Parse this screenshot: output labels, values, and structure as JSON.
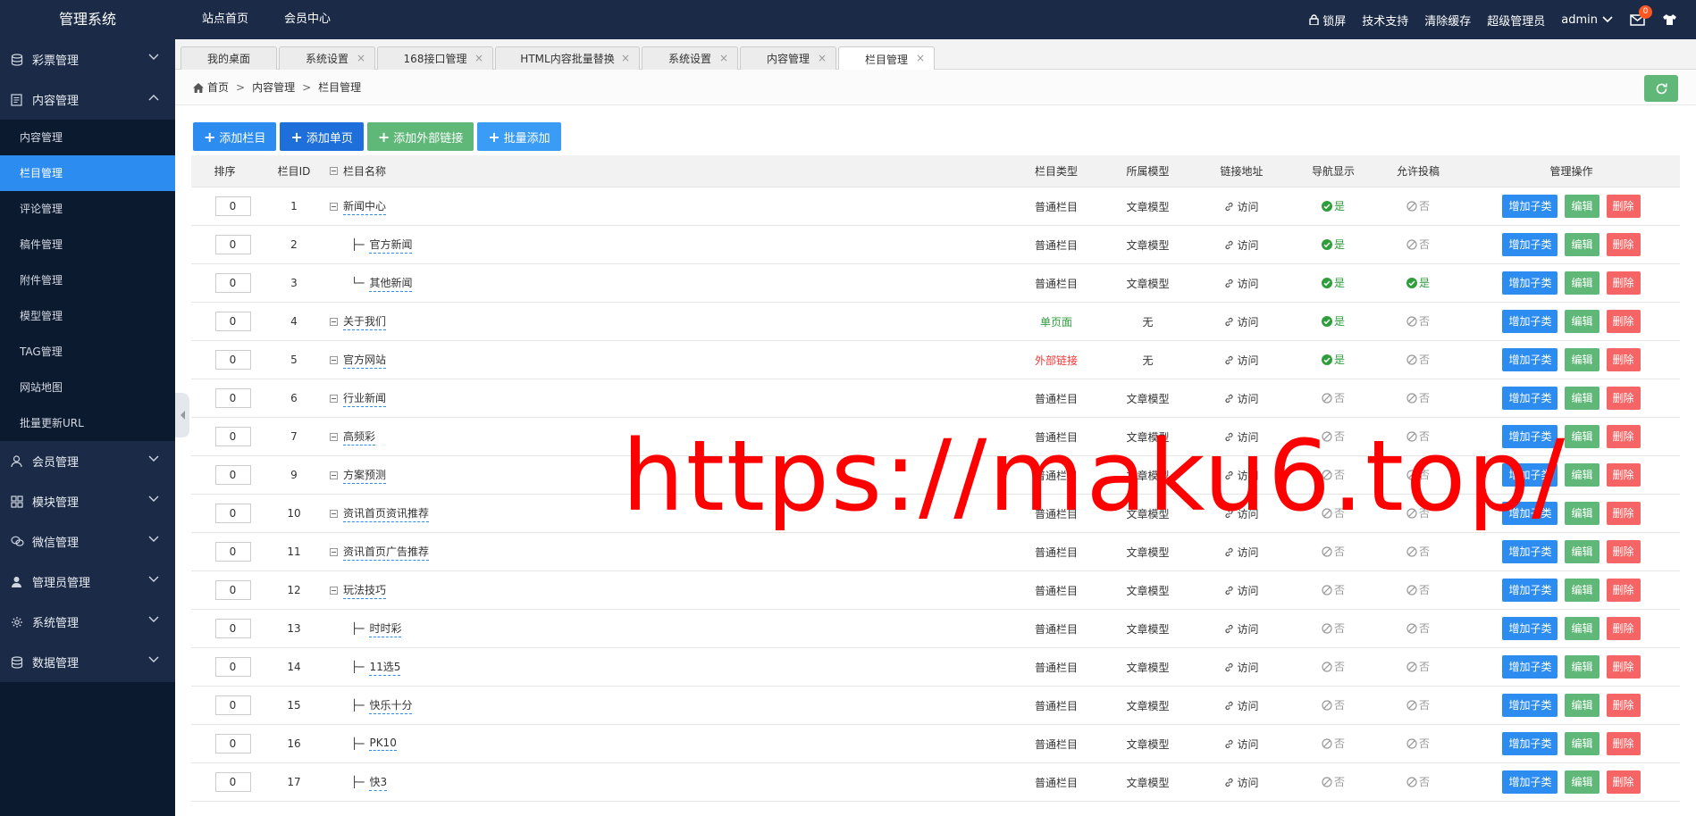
{
  "app": {
    "title": "管理系统",
    "top_nav": [
      "站点首页",
      "会员中心"
    ],
    "top_right": {
      "lock": "锁屏",
      "support": "技术支持",
      "clear_cache": "清除缓存",
      "role": "超级管理员",
      "user": "admin",
      "mail_count": "0"
    }
  },
  "sidebar": {
    "groups_top": [
      {
        "label": "彩票管理",
        "icon": "database-icon"
      },
      {
        "label": "内容管理",
        "icon": "document-icon"
      }
    ],
    "content_items": [
      "内容管理",
      "栏目管理",
      "评论管理",
      "稿件管理",
      "附件管理",
      "模型管理",
      "TAG管理",
      "网站地图",
      "批量更新URL"
    ],
    "active_item": "栏目管理",
    "groups_bottom": [
      {
        "label": "会员管理",
        "icon": "user-icon"
      },
      {
        "label": "模块管理",
        "icon": "grid-icon"
      },
      {
        "label": "微信管理",
        "icon": "wechat-icon"
      },
      {
        "label": "管理员管理",
        "icon": "admin-icon"
      },
      {
        "label": "系统管理",
        "icon": "gear-icon"
      },
      {
        "label": "数据管理",
        "icon": "database-icon"
      }
    ]
  },
  "tabs": [
    "我的桌面",
    "系统设置",
    "168接口管理",
    "HTML内容批量替换",
    "系统设置",
    "内容管理",
    "栏目管理"
  ],
  "breadcrumb": [
    "首页",
    "内容管理",
    "栏目管理"
  ],
  "actions": [
    {
      "label": "添加栏目",
      "color": "#2d8cf0"
    },
    {
      "label": "添加单页",
      "color": "#1e6fd9"
    },
    {
      "label": "添加外部链接",
      "color": "#5fb878"
    },
    {
      "label": "批量添加",
      "color": "#3b9cf5"
    }
  ],
  "table": {
    "headers": {
      "sort": "排序",
      "id": "栏目ID",
      "name": "栏目名称",
      "type": "栏目类型",
      "model": "所属模型",
      "link": "链接地址",
      "nav": "导航显示",
      "post": "允许投稿",
      "op": "管理操作"
    },
    "link_text": "访问",
    "yes_text": "是",
    "no_text": "否",
    "btn_add": "增加子类",
    "btn_edit": "编辑",
    "btn_del": "删除",
    "rows": [
      {
        "sort": "0",
        "id": "1",
        "name": "新闻中心",
        "level": 0,
        "prefix": "",
        "type": "普通栏目",
        "type_color": "#333333",
        "model": "文章模型",
        "nav": true,
        "post": false
      },
      {
        "sort": "0",
        "id": "2",
        "name": "官方新闻",
        "level": 1,
        "prefix": "├─",
        "type": "普通栏目",
        "type_color": "#333333",
        "model": "文章模型",
        "nav": true,
        "post": false
      },
      {
        "sort": "0",
        "id": "3",
        "name": "其他新闻",
        "level": 1,
        "prefix": "└─",
        "type": "普通栏目",
        "type_color": "#333333",
        "model": "文章模型",
        "nav": true,
        "post": true
      },
      {
        "sort": "0",
        "id": "4",
        "name": "关于我们",
        "level": 0,
        "prefix": "",
        "type": "单页面",
        "type_color": "#2e9e3b",
        "model": "无",
        "nav": true,
        "post": false
      },
      {
        "sort": "0",
        "id": "5",
        "name": "官方网站",
        "level": 0,
        "prefix": "",
        "type": "外部链接",
        "type_color": "#ff3333",
        "model": "无",
        "nav": true,
        "post": false
      },
      {
        "sort": "0",
        "id": "6",
        "name": "行业新闻",
        "level": 0,
        "prefix": "",
        "type": "普通栏目",
        "type_color": "#333333",
        "model": "文章模型",
        "nav": false,
        "post": false
      },
      {
        "sort": "0",
        "id": "7",
        "name": "高频彩",
        "level": 0,
        "prefix": "",
        "type": "普通栏目",
        "type_color": "#333333",
        "model": "文章模型",
        "nav": false,
        "post": false
      },
      {
        "sort": "0",
        "id": "9",
        "name": "方案预测",
        "level": 0,
        "prefix": "",
        "type": "普通栏目",
        "type_color": "#333333",
        "model": "文章模型",
        "nav": false,
        "post": false
      },
      {
        "sort": "0",
        "id": "10",
        "name": "资讯首页资讯推荐",
        "level": 0,
        "prefix": "",
        "type": "普通栏目",
        "type_color": "#333333",
        "model": "文章模型",
        "nav": false,
        "post": false
      },
      {
        "sort": "0",
        "id": "11",
        "name": "资讯首页广告推荐",
        "level": 0,
        "prefix": "",
        "type": "普通栏目",
        "type_color": "#333333",
        "model": "文章模型",
        "nav": false,
        "post": false
      },
      {
        "sort": "0",
        "id": "12",
        "name": "玩法技巧",
        "level": 0,
        "prefix": "",
        "type": "普通栏目",
        "type_color": "#333333",
        "model": "文章模型",
        "nav": false,
        "post": false
      },
      {
        "sort": "0",
        "id": "13",
        "name": "时时彩",
        "level": 1,
        "prefix": "├─",
        "type": "普通栏目",
        "type_color": "#333333",
        "model": "文章模型",
        "nav": false,
        "post": false
      },
      {
        "sort": "0",
        "id": "14",
        "name": "11选5",
        "level": 1,
        "prefix": "├─",
        "type": "普通栏目",
        "type_color": "#333333",
        "model": "文章模型",
        "nav": false,
        "post": false
      },
      {
        "sort": "0",
        "id": "15",
        "name": "快乐十分",
        "level": 1,
        "prefix": "├─",
        "type": "普通栏目",
        "type_color": "#333333",
        "model": "文章模型",
        "nav": false,
        "post": false
      },
      {
        "sort": "0",
        "id": "16",
        "name": "PK10",
        "level": 1,
        "prefix": "├─",
        "type": "普通栏目",
        "type_color": "#333333",
        "model": "文章模型",
        "nav": false,
        "post": false
      },
      {
        "sort": "0",
        "id": "17",
        "name": "快3",
        "level": 1,
        "prefix": "├─",
        "type": "普通栏目",
        "type_color": "#333333",
        "model": "文章模型",
        "nav": false,
        "post": false
      }
    ]
  },
  "watermark": "https://maku6.top/"
}
